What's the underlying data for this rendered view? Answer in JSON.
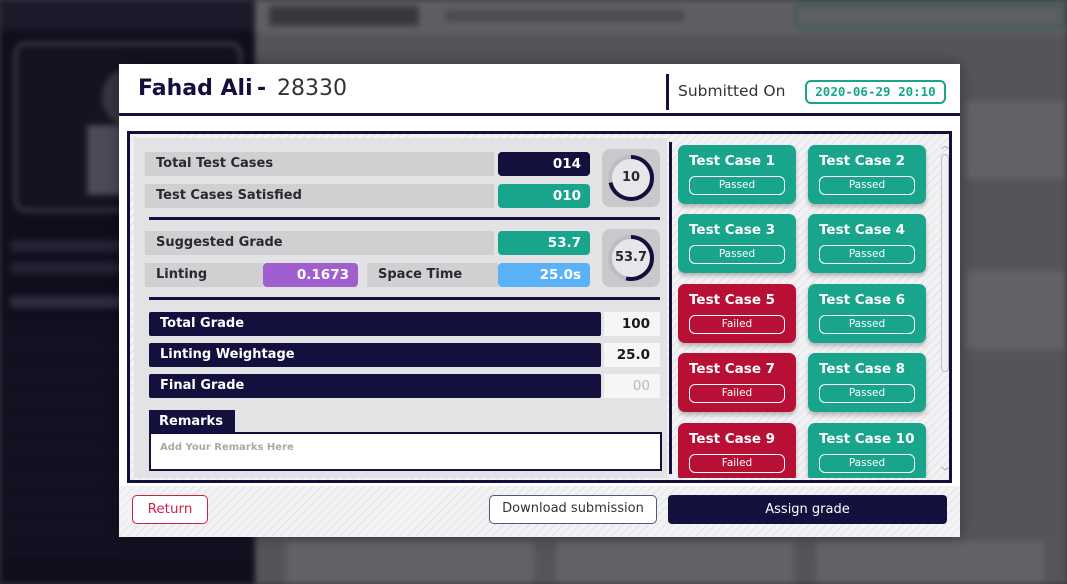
{
  "modal": {
    "student_name": "Fahad Ali",
    "separator": "-",
    "student_id": "28330",
    "submitted_label": "Submitted On",
    "submitted_date": "2020-06-29 20:10"
  },
  "stats": {
    "total_test_cases_label": "Total Test Cases",
    "total_test_cases_value": "014",
    "test_cases_satisfied_label": "Test Cases Satisfied",
    "test_cases_satisfied_value": "010",
    "satisfied_ring_value": "10",
    "satisfied_ring_fraction": 0.714,
    "suggested_grade_label": "Suggested Grade",
    "suggested_grade_value": "53.7",
    "suggested_ring_value": "53.7",
    "suggested_ring_fraction": 0.537,
    "linting_label": "Linting",
    "linting_value": "0.1673",
    "space_time_label": "Space Time",
    "space_time_value": "25.0s"
  },
  "grades": {
    "total_grade_label": "Total Grade",
    "total_grade_value": "100",
    "linting_weightage_label": "Linting Weightage",
    "linting_weightage_value": "25.0",
    "final_grade_label": "Final Grade",
    "final_grade_value": "00"
  },
  "remarks": {
    "label": "Remarks",
    "placeholder": "Add Your Remarks Here"
  },
  "test_cases": [
    {
      "name": "Test Case 1",
      "status": "Passed"
    },
    {
      "name": "Test Case 2",
      "status": "Passed"
    },
    {
      "name": "Test Case 3",
      "status": "Passed"
    },
    {
      "name": "Test Case 4",
      "status": "Passed"
    },
    {
      "name": "Test Case 5",
      "status": "Failed"
    },
    {
      "name": "Test Case 6",
      "status": "Passed"
    },
    {
      "name": "Test Case 7",
      "status": "Failed"
    },
    {
      "name": "Test Case 8",
      "status": "Passed"
    },
    {
      "name": "Test Case 9",
      "status": "Failed"
    },
    {
      "name": "Test Case 10",
      "status": "Passed"
    }
  ],
  "footer": {
    "return_label": "Return",
    "download_label": "Download submission",
    "assign_label": "Assign grade"
  },
  "colors": {
    "navy": "#14103e",
    "teal": "#18a58c",
    "red": "#b80f35",
    "purple": "#9f5fce",
    "blue": "#5bb1f5"
  }
}
